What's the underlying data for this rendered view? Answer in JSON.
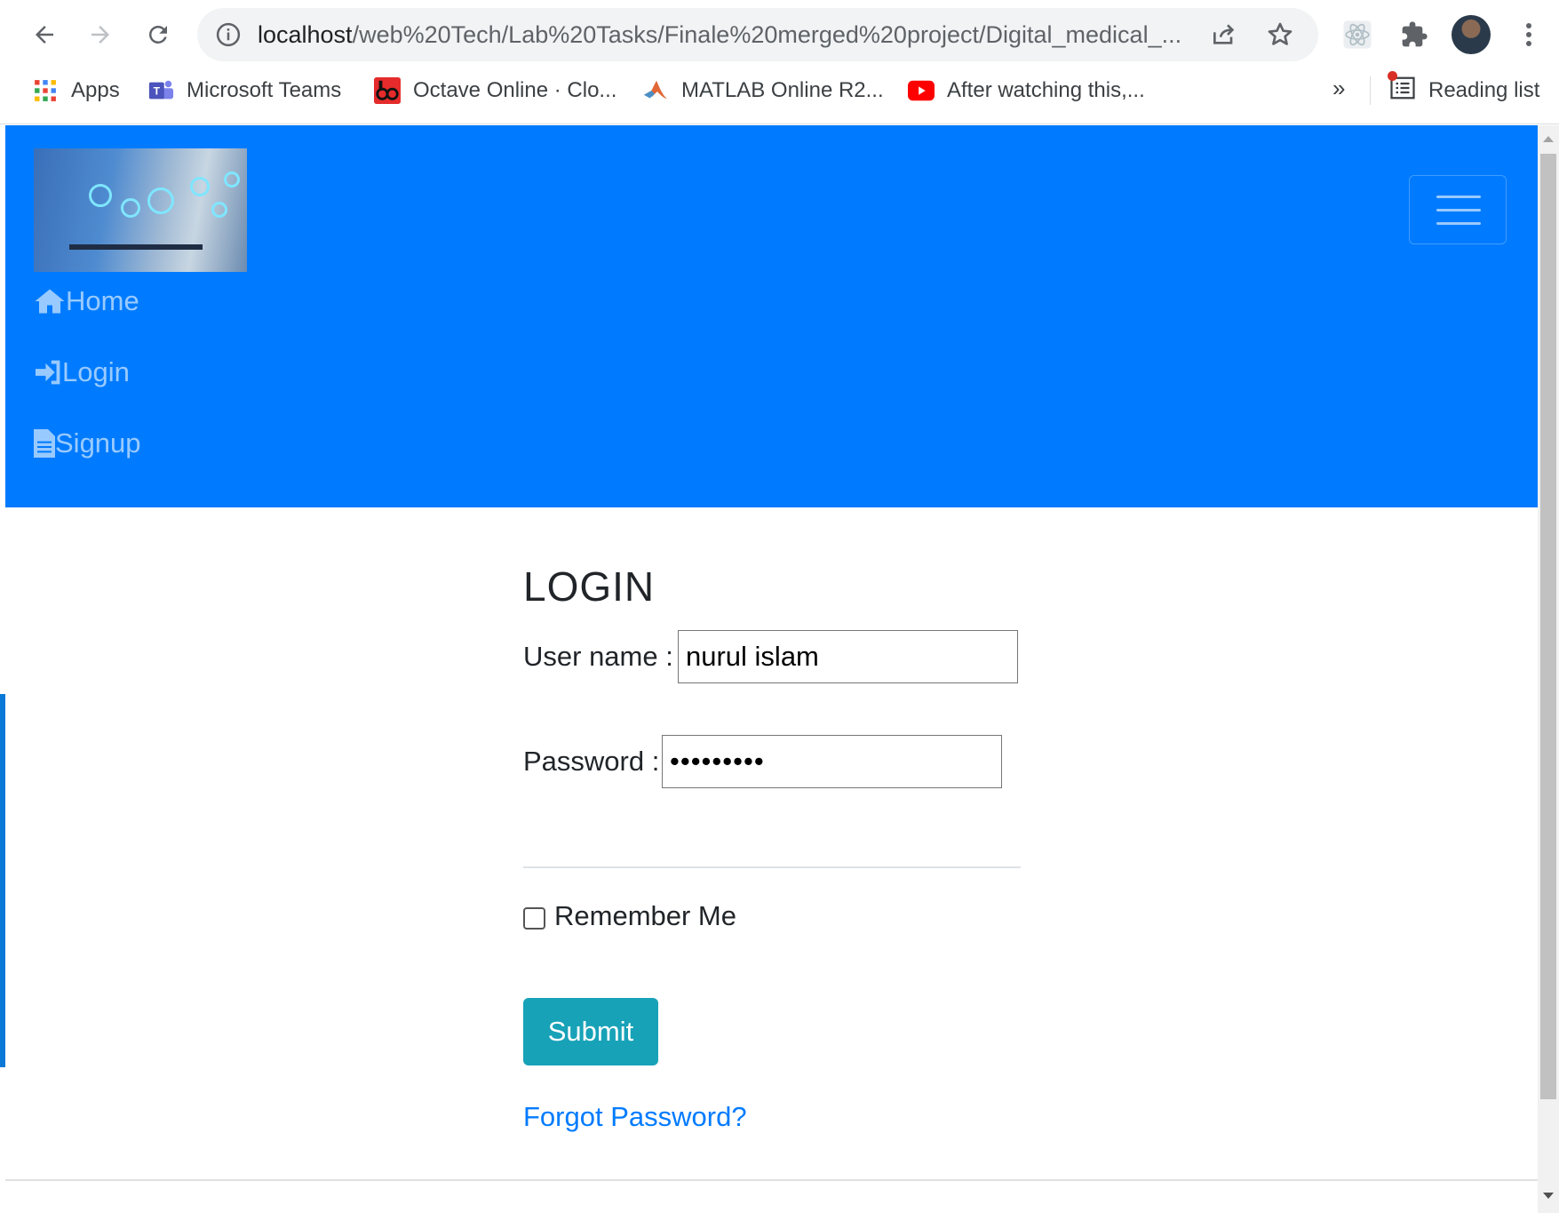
{
  "browser": {
    "url_host": "localhost",
    "url_path": "/web%20Tech/Lab%20Tasks/Finale%20merged%20project/Digital_medical_...",
    "bookmarks": [
      {
        "label": "Apps",
        "icon": "apps-grid-icon"
      },
      {
        "label": "Microsoft Teams",
        "icon": "teams-icon"
      },
      {
        "label": "Octave Online · Clo...",
        "icon": "octave-icon"
      },
      {
        "label": "MATLAB Online R2...",
        "icon": "matlab-icon"
      },
      {
        "label": "After watching this,...",
        "icon": "youtube-icon"
      }
    ],
    "more_bookmarks": "»",
    "reading_list": "Reading list"
  },
  "navbar": {
    "links": [
      {
        "label": "Home",
        "icon": "home-icon"
      },
      {
        "label": "Login",
        "icon": "sign-in-icon"
      },
      {
        "label": "Signup",
        "icon": "file-icon"
      }
    ]
  },
  "login": {
    "title": "LOGIN",
    "username_label": "User name :",
    "username_value": "nurul islam",
    "password_label": "Password :",
    "password_value": "•••••••••",
    "remember_label": "Remember Me",
    "remember_checked": false,
    "submit_label": "Submit",
    "forgot_label": "Forgot Password?"
  },
  "colors": {
    "navbar_bg": "#007bff",
    "submit_bg": "#17a2b8",
    "link": "#007bff"
  }
}
